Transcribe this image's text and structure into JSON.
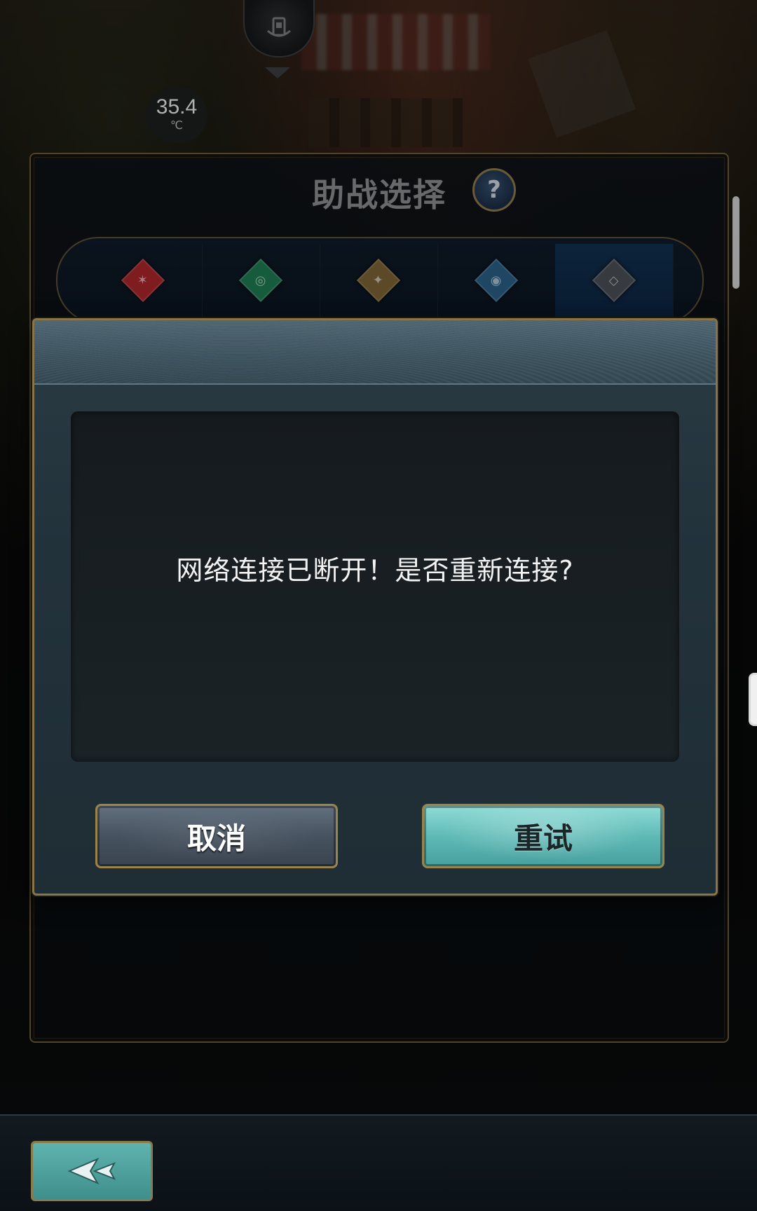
{
  "status": {
    "temperature_value": "35.4",
    "temperature_unit": "℃"
  },
  "top": {
    "location_icon": "map-pin-icon",
    "expand_icon": "chevron-down-icon"
  },
  "panel": {
    "title": "助战选择",
    "help_label": "?",
    "element_tabs": [
      {
        "id": "fire",
        "color": "#a8262a",
        "glyph": "🜂"
      },
      {
        "id": "wind",
        "color": "#1f7a52",
        "glyph": "◎"
      },
      {
        "id": "earth",
        "color": "#7b6234",
        "glyph": "◆"
      },
      {
        "id": "water",
        "color": "#2a5f86",
        "glyph": "◉"
      },
      {
        "id": "neutral",
        "color": "#4a4f55",
        "glyph": "◇"
      }
    ],
    "selected_tab_index": 4
  },
  "dialog": {
    "message": "网络连接已断开！是否重新连接?",
    "cancel_label": "取消",
    "retry_label": "重试"
  },
  "footer": {
    "back_icon": "back-arrow-icon"
  }
}
